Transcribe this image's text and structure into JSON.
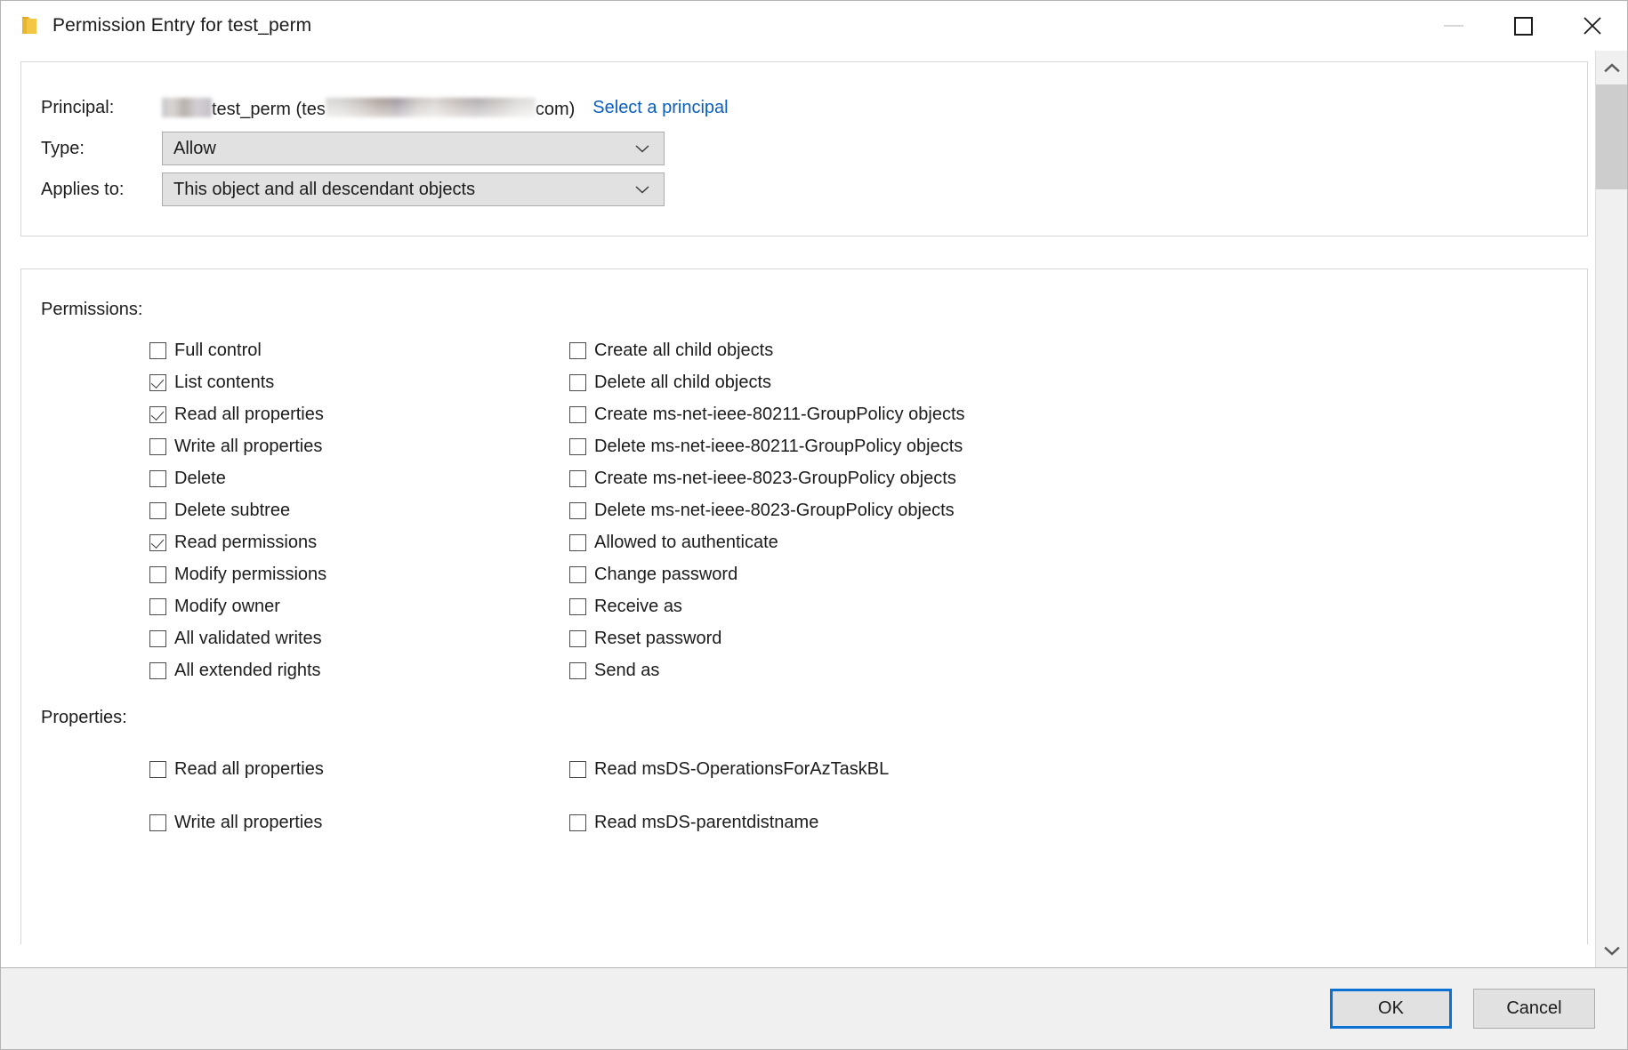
{
  "window": {
    "title": "Permission Entry for test_perm",
    "icon": "folder-icon",
    "minimize_label": "Minimize",
    "maximize_label": "Maximize",
    "close_label": "Close"
  },
  "principal": {
    "label": "Principal:",
    "value_prefix": "test_perm (tes",
    "value_suffix": "com)",
    "select_link": "Select a principal"
  },
  "type": {
    "label": "Type:",
    "value": "Allow"
  },
  "applies_to": {
    "label": "Applies to:",
    "value": "This object and all descendant objects"
  },
  "permissions": {
    "heading": "Permissions:",
    "left": [
      {
        "label": "Full control",
        "checked": false
      },
      {
        "label": "List contents",
        "checked": true
      },
      {
        "label": "Read all properties",
        "checked": true
      },
      {
        "label": "Write all properties",
        "checked": false
      },
      {
        "label": "Delete",
        "checked": false
      },
      {
        "label": "Delete subtree",
        "checked": false
      },
      {
        "label": "Read permissions",
        "checked": true
      },
      {
        "label": "Modify permissions",
        "checked": false
      },
      {
        "label": "Modify owner",
        "checked": false
      },
      {
        "label": "All validated writes",
        "checked": false
      },
      {
        "label": "All extended rights",
        "checked": false
      }
    ],
    "right": [
      {
        "label": "Create all child objects",
        "checked": false
      },
      {
        "label": "Delete all child objects",
        "checked": false
      },
      {
        "label": "Create ms-net-ieee-80211-GroupPolicy objects",
        "checked": false
      },
      {
        "label": "Delete ms-net-ieee-80211-GroupPolicy objects",
        "checked": false
      },
      {
        "label": "Create ms-net-ieee-8023-GroupPolicy objects",
        "checked": false
      },
      {
        "label": "Delete ms-net-ieee-8023-GroupPolicy objects",
        "checked": false
      },
      {
        "label": "Allowed to authenticate",
        "checked": false
      },
      {
        "label": "Change password",
        "checked": false
      },
      {
        "label": "Receive as",
        "checked": false
      },
      {
        "label": "Reset password",
        "checked": false
      },
      {
        "label": "Send as",
        "checked": false
      }
    ]
  },
  "properties": {
    "heading": "Properties:",
    "left": [
      {
        "label": "Read all properties",
        "checked": false
      },
      {
        "label": "Write all properties",
        "checked": false
      }
    ],
    "right": [
      {
        "label": "Read msDS-OperationsForAzTaskBL",
        "checked": false
      },
      {
        "label": "Read msDS-parentdistname",
        "checked": false
      }
    ]
  },
  "footer": {
    "ok_label": "OK",
    "cancel_label": "Cancel"
  },
  "scrollbar": {
    "up_icon": "chevron-up-icon",
    "down_icon": "chevron-down-icon"
  },
  "colors": {
    "link": "#0b5fbe",
    "focus_border": "#0b72d4",
    "folder": "#ecb31f",
    "text": "#1c1c1c",
    "footer_bg": "#f0f0f0"
  }
}
